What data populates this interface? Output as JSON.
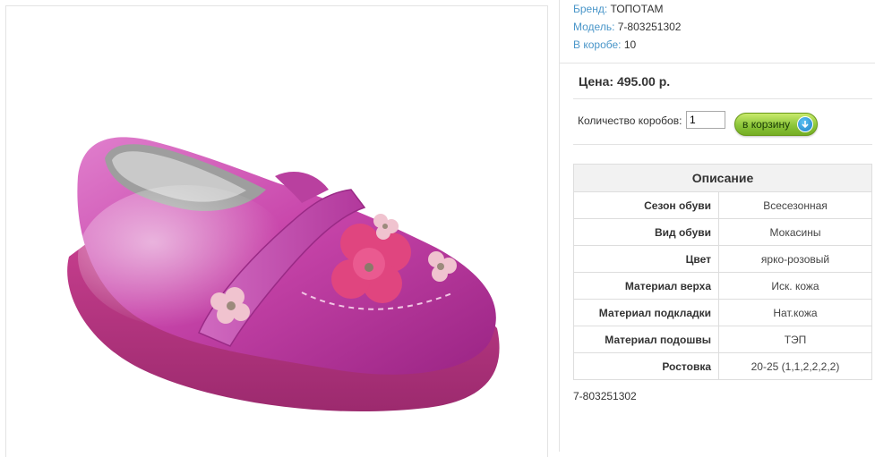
{
  "product": {
    "attributes": [
      {
        "label": "Бренд:",
        "value": "ТОПОТАМ"
      },
      {
        "label": "Модель:",
        "value": "7-803251302"
      },
      {
        "label": "В коробе:",
        "value": "10"
      }
    ],
    "price": "Цена: 495.00 р.",
    "quantity_label": "Количество коробов:",
    "quantity_value": "1",
    "cart_button_label": "в корзину",
    "article_code": "7-803251302",
    "image_name": "pink-shoe-image"
  },
  "description": {
    "title": "Описание",
    "rows": [
      {
        "key": "Сезон обуви",
        "value": "Всесезонная"
      },
      {
        "key": "Вид обуви",
        "value": "Мокасины"
      },
      {
        "key": "Цвет",
        "value": "ярко-розовый"
      },
      {
        "key": "Материал верха",
        "value": "Иск. кожа"
      },
      {
        "key": "Материал подкладки",
        "value": "Нат.кожа"
      },
      {
        "key": "Материал подошвы",
        "value": "ТЭП"
      },
      {
        "key": "Ростовка",
        "value": "20-25 (1,1,2,2,2,2)"
      }
    ]
  },
  "colors": {
    "label_blue": "#4a96c9",
    "button_green": "#8cc63a",
    "shoe_pink": "#c846a8",
    "divider": "#e3e3e3"
  },
  "icons": {
    "cart": "arrow-down-circle-icon"
  }
}
